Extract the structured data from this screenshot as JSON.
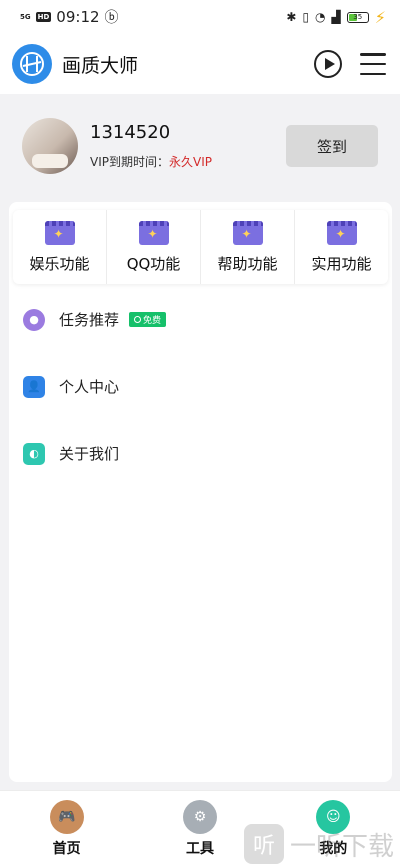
{
  "status_bar": {
    "net_tag": "5G",
    "hd_tag": "HD",
    "time": "09:12",
    "extra_icon": "ⓑ",
    "right_icons": [
      "bluetooth-icon",
      "vibrate-icon",
      "alarm-icon",
      "5g-signal-icon"
    ],
    "battery_level": "35",
    "charging": true
  },
  "header": {
    "title": "画质大师",
    "accent_color": "#2e8ce8"
  },
  "profile": {
    "user_id": "1314520",
    "vip_label": "VIP到期时间：",
    "vip_value": "永久VIP",
    "checkin_label": "签到"
  },
  "functions": [
    {
      "label": "娱乐功能",
      "icon": "clapper-wand-icon"
    },
    {
      "label": "QQ功能",
      "icon": "clapper-wand-icon"
    },
    {
      "label": "帮助功能",
      "icon": "clapper-wand-icon"
    },
    {
      "label": "实用功能",
      "icon": "clapper-wand-icon"
    }
  ],
  "list": [
    {
      "label": "任务推荐",
      "icon": "task-icon",
      "badge": "免费"
    },
    {
      "label": "个人中心",
      "icon": "person-folder-icon"
    },
    {
      "label": "关于我们",
      "icon": "about-icon"
    }
  ],
  "bottom_nav": [
    {
      "label": "首页",
      "icon": "gamepad-icon"
    },
    {
      "label": "工具",
      "icon": "tools-icon"
    },
    {
      "label": "我的",
      "icon": "mine-icon"
    }
  ],
  "watermark": {
    "icon_text": "听",
    "text": "一听下载"
  }
}
